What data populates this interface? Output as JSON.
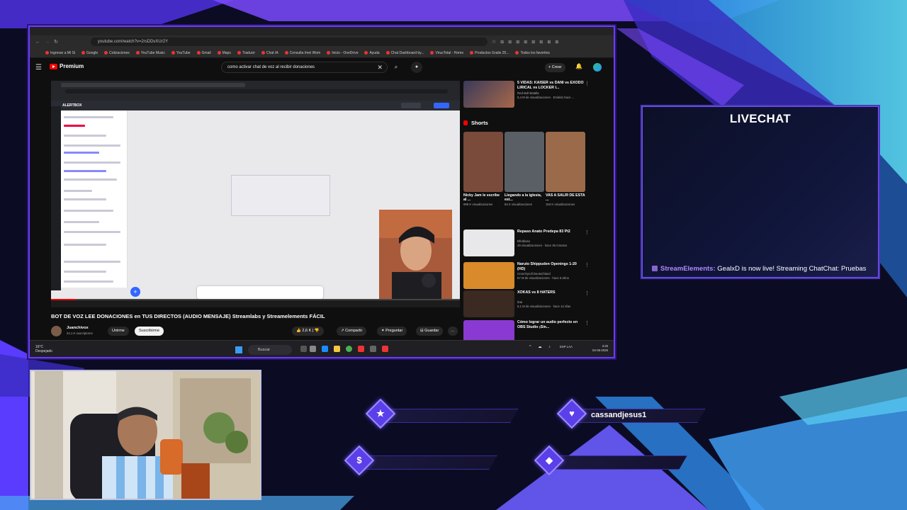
{
  "browser": {
    "url": "youtube.com/watch?v=2rsDDvXUr2Y",
    "bookmarks": [
      "Ingresar a Mi Si",
      "Google",
      "Cotizaciones",
      "YouTube Music",
      "YouTube",
      "Gmail",
      "Maps",
      "Traducir",
      "Chat IA",
      "Consulta Imei Wom",
      "Inicio - OneDrive",
      "Ayuda",
      "Chat Dashboard by...",
      "VirusTotal - Home",
      "Productos Gratis 25...",
      "Todos los favoritos"
    ]
  },
  "youtube": {
    "brand": "Premium",
    "search_query": "como activar chat de voz al recibir donaciones",
    "create_label": "+ Crear",
    "video_title": "BOT DE VOZ LEE DONACIONES en TUS DIRECTOS (AUDIO MENSAJE) Streamlabs y Streamelements FÁCIL",
    "channel_name": "Juanchivox",
    "channel_subs": "24,1 K suscriptores",
    "unirme": "Unirme",
    "subscribe": "Suscribirme",
    "likes": "2,6 K",
    "share": "Compartir",
    "ask": "Preguntar",
    "save": "Guardar",
    "inner_header": "ALERTBOX",
    "progress": 0.06
  },
  "sidebar": {
    "top": {
      "title": "5 VIDAS: KAISER vs DANI vs ÉXODO LIRICAL vs LOCKER I...",
      "channel": "Red Bull Batalla",
      "meta": "5,4 M de visualizaciones · Emitido hace ..."
    },
    "shorts_header": "Shorts",
    "shorts": [
      {
        "title": "Nicky Jam le escribe al ...",
        "views": "999 K visualizaciones",
        "color": "#7a4a3a"
      },
      {
        "title": "Llegando a la iglesia, est...",
        "views": "84 K visualizaciones",
        "color": "#5a5f66"
      },
      {
        "title": "VAS A SALIR DE ESTA ...",
        "views": "153 K visualizaciones",
        "color": "#9a6a4a"
      }
    ],
    "items": [
      {
        "title": "Repaso Anato Predepa 83 Pt2",
        "channel": "Bfroblaso",
        "meta": "29 visualizaciones · hace 36 minutos",
        "color": "#e8e8ea"
      },
      {
        "title": "Naruto Shippuden Openings 1-20 (HD)",
        "channel": "Crunchyroll Deutschland",
        "meta": "67 M de visualizaciones · hace 8 años",
        "color": "#d98a2a"
      },
      {
        "title": "XOKAS vs 8 HATERS",
        "channel": "Ibai",
        "meta": "6,1 M de visualizaciones · hace 12 días",
        "color": "#3a2a22"
      },
      {
        "title": "Cómo lograr un audio perfecto en OBS Studio ¡Sin...",
        "channel": "",
        "meta": "",
        "color": "#8a3ad2"
      }
    ]
  },
  "taskbar": {
    "weather_temp": "16°C",
    "weather_desc": "Despejado",
    "search": "Buscar",
    "lang": "ESP LAA",
    "time": "3:25",
    "date": "04-05-2025"
  },
  "livechat": {
    "title": "LIVECHAT",
    "user": "StreamElements:",
    "message": "GealxD is now live! Streaming ChatChat: Pruebas"
  },
  "alerts": {
    "follower": "",
    "subscriber": "cassandjesus1",
    "donation": "",
    "bits": ""
  },
  "colors": {
    "accent": "#6a3cff",
    "youtube_red": "#ff0000",
    "chat_user": "#b08aff"
  }
}
